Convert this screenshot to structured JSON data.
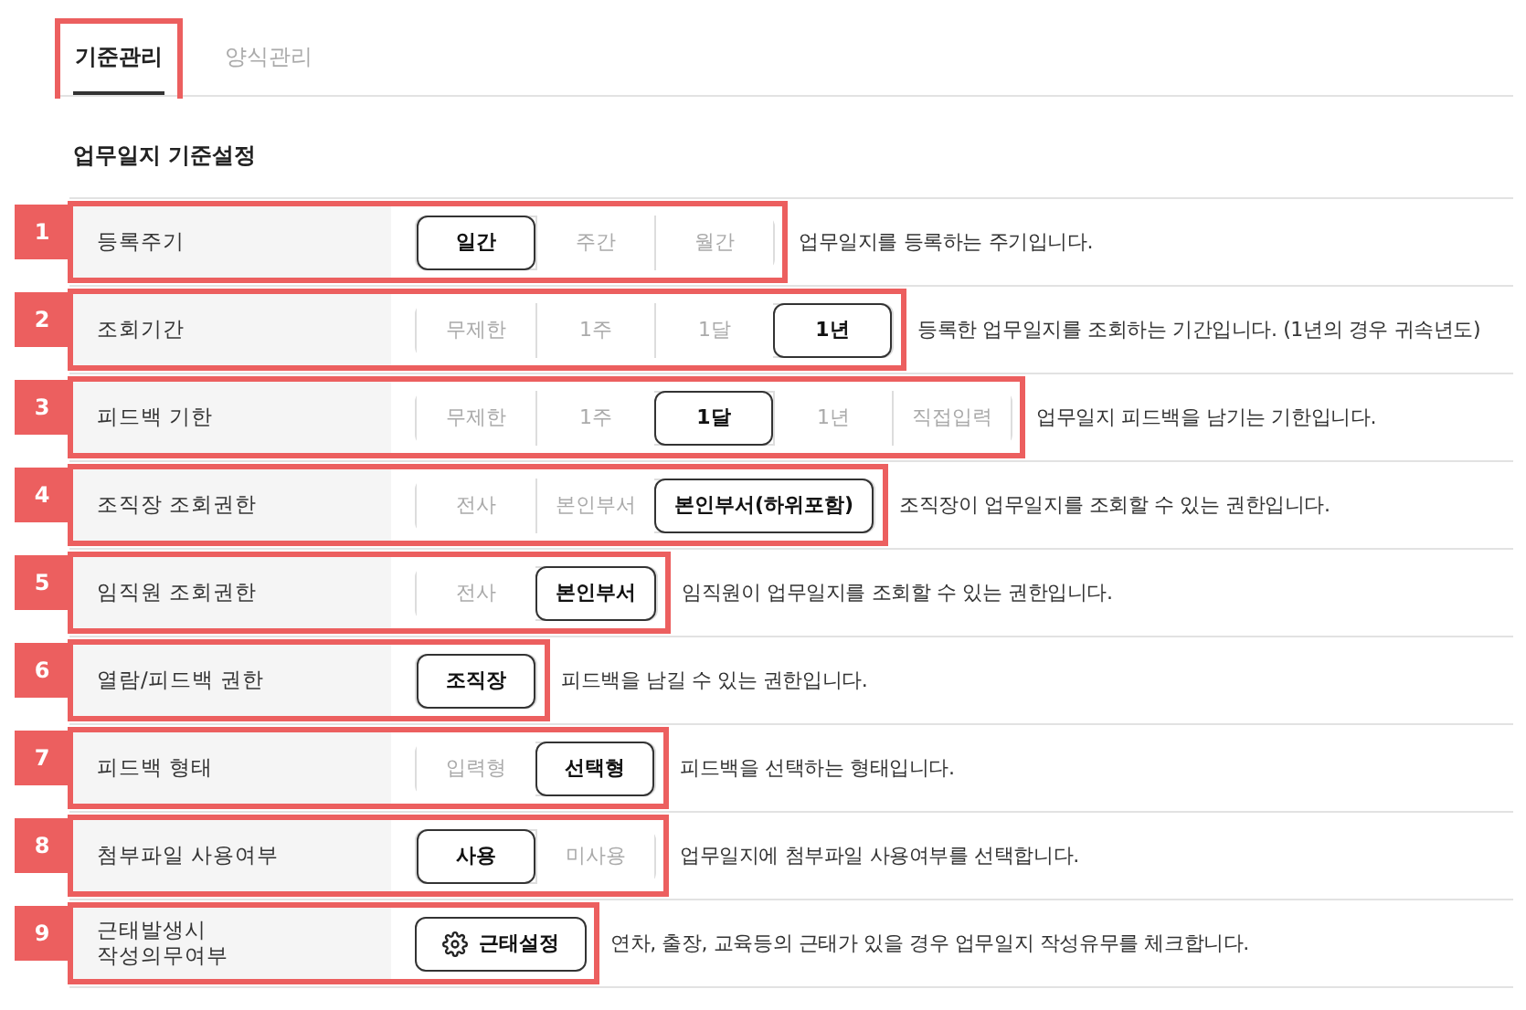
{
  "tabs": [
    {
      "label": "기준관리",
      "selected": true,
      "highlighted": true
    },
    {
      "label": "양식관리",
      "selected": false,
      "highlighted": false
    }
  ],
  "section_title": "업무일지 기준설정",
  "rows": [
    {
      "marker": "1",
      "label": "등록주기",
      "kind": "segmented",
      "options": [
        {
          "label": "일간",
          "selected": true
        },
        {
          "label": "주간",
          "selected": false
        },
        {
          "label": "월간",
          "selected": false
        }
      ],
      "description": "업무일지를 등록하는 주기입니다."
    },
    {
      "marker": "2",
      "label": "조회기간",
      "kind": "segmented",
      "options": [
        {
          "label": "무제한",
          "selected": false
        },
        {
          "label": "1주",
          "selected": false
        },
        {
          "label": "1달",
          "selected": false
        },
        {
          "label": "1년",
          "selected": true
        }
      ],
      "description": "등록한 업무일지를 조회하는 기간입니다. (1년의 경우 귀속년도)"
    },
    {
      "marker": "3",
      "label": "피드백 기한",
      "kind": "segmented",
      "options": [
        {
          "label": "무제한",
          "selected": false
        },
        {
          "label": "1주",
          "selected": false
        },
        {
          "label": "1달",
          "selected": true
        },
        {
          "label": "1년",
          "selected": false
        },
        {
          "label": "직접입력",
          "selected": false
        }
      ],
      "description": "업무일지 피드백을 남기는 기한입니다."
    },
    {
      "marker": "4",
      "label": "조직장 조회권한",
      "kind": "segmented",
      "options": [
        {
          "label": "전사",
          "selected": false
        },
        {
          "label": "본인부서",
          "selected": false
        },
        {
          "label": "본인부서(하위포함)",
          "selected": true
        }
      ],
      "description": "조직장이 업무일지를 조회할 수 있는 권한입니다."
    },
    {
      "marker": "5",
      "label": "임직원 조회권한",
      "kind": "segmented",
      "options": [
        {
          "label": "전사",
          "selected": false
        },
        {
          "label": "본인부서",
          "selected": true
        }
      ],
      "description": "임직원이 업무일지를 조회할 수 있는 권한입니다."
    },
    {
      "marker": "6",
      "label": "열람/피드백 권한",
      "kind": "segmented",
      "options": [
        {
          "label": "조직장",
          "selected": true
        }
      ],
      "description": "피드백을 남길 수 있는 권한입니다."
    },
    {
      "marker": "7",
      "label": "피드백 형태",
      "kind": "segmented",
      "options": [
        {
          "label": "입력형",
          "selected": false
        },
        {
          "label": "선택형",
          "selected": true
        }
      ],
      "description": "피드백을 선택하는 형태입니다."
    },
    {
      "marker": "8",
      "label": "첨부파일 사용여부",
      "kind": "segmented",
      "options": [
        {
          "label": "사용",
          "selected": true
        },
        {
          "label": "미사용",
          "selected": false
        }
      ],
      "description": "업무일지에 첨부파일 사용여부를 선택합니다."
    },
    {
      "marker": "9",
      "label": "근태발생시\n작성의무여부",
      "kind": "button",
      "button": "근태설정",
      "description": "연차, 출장, 교육등의 근태가 있을 경우 업무일지 작성유무를 체크합니다."
    }
  ]
}
